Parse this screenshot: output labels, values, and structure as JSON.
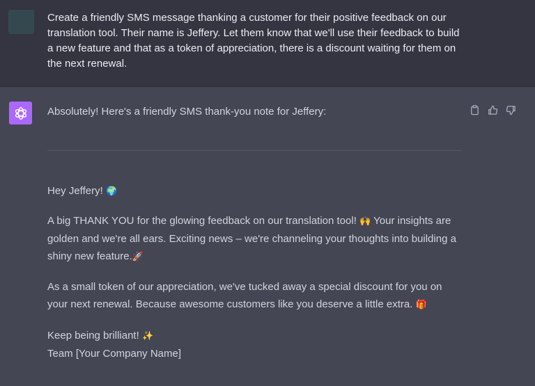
{
  "user_message": {
    "text": "Create a friendly SMS message thanking a customer for their positive feedback on our translation tool. Their name is Jeffery. Let them know that we'll use their feedback to build a new feature and that as a token of appreciation, there is a discount waiting for them on the next renewal."
  },
  "assistant_message": {
    "intro": "Absolutely! Here's a friendly SMS thank-you note for Jeffery:",
    "greeting": "Hey Jeffery!",
    "greeting_emoji": "🌍",
    "thanks_text": "A big THANK YOU for the glowing feedback on our translation tool!",
    "thanks_emoji": "🙌",
    "thanks_rest": " Your insights are golden and we're all ears. Exciting news – we're channeling your thoughts into building a shiny new feature.",
    "feature_emoji": "🚀",
    "discount_text": "As a small token of our appreciation, we've tucked away a special discount for you on your next renewal. Because awesome customers like you deserve a little extra.",
    "discount_emoji": "🎁",
    "signoff": "Keep being brilliant!",
    "signoff_emoji": "✨",
    "signature": "Team [Your Company Name]"
  },
  "actions": {
    "copy_icon": "clipboard-icon",
    "like_icon": "thumbs-up-icon",
    "dislike_icon": "thumbs-down-icon"
  },
  "colors": {
    "user_bg": "#343541",
    "assistant_bg": "#444654",
    "assistant_avatar": "#ab68ff",
    "text": "#d1d5db"
  }
}
